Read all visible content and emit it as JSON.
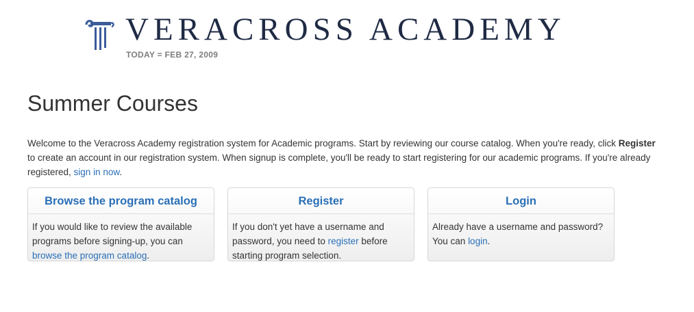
{
  "header": {
    "brand_name": "VERACROSS ACADEMY",
    "today_line": "TODAY = FEB 27, 2009",
    "logo_icon": "greek-column-icon"
  },
  "page_title": "Summer Courses",
  "intro": {
    "part1": "Welcome to the Veracross Academy registration system for Academic programs. Start by reviewing our course catalog. When you're ready, click ",
    "register_bold": "Register",
    "part2": " to create an account in our registration system. When signup is complete, you'll be ready to start registering for our academic programs. If you're already registered, ",
    "sign_in_link": "sign in now",
    "part3": "."
  },
  "panels": [
    {
      "title": "Browse the program catalog",
      "text_before": "If you would like to review the available programs before signing-up, you can ",
      "link": "browse the program catalog",
      "text_after": "."
    },
    {
      "title": "Register",
      "text_before": "If you don't yet have a username and password, you need to ",
      "link": "register",
      "text_after": " before starting program selection."
    },
    {
      "title": "Login",
      "text_before": "Already have a username and password? You can ",
      "link": "login",
      "text_after": "."
    }
  ],
  "colors": {
    "link": "#2a6fb7",
    "brand": "#1f2a44",
    "logo_accent": "#3b5c99"
  }
}
